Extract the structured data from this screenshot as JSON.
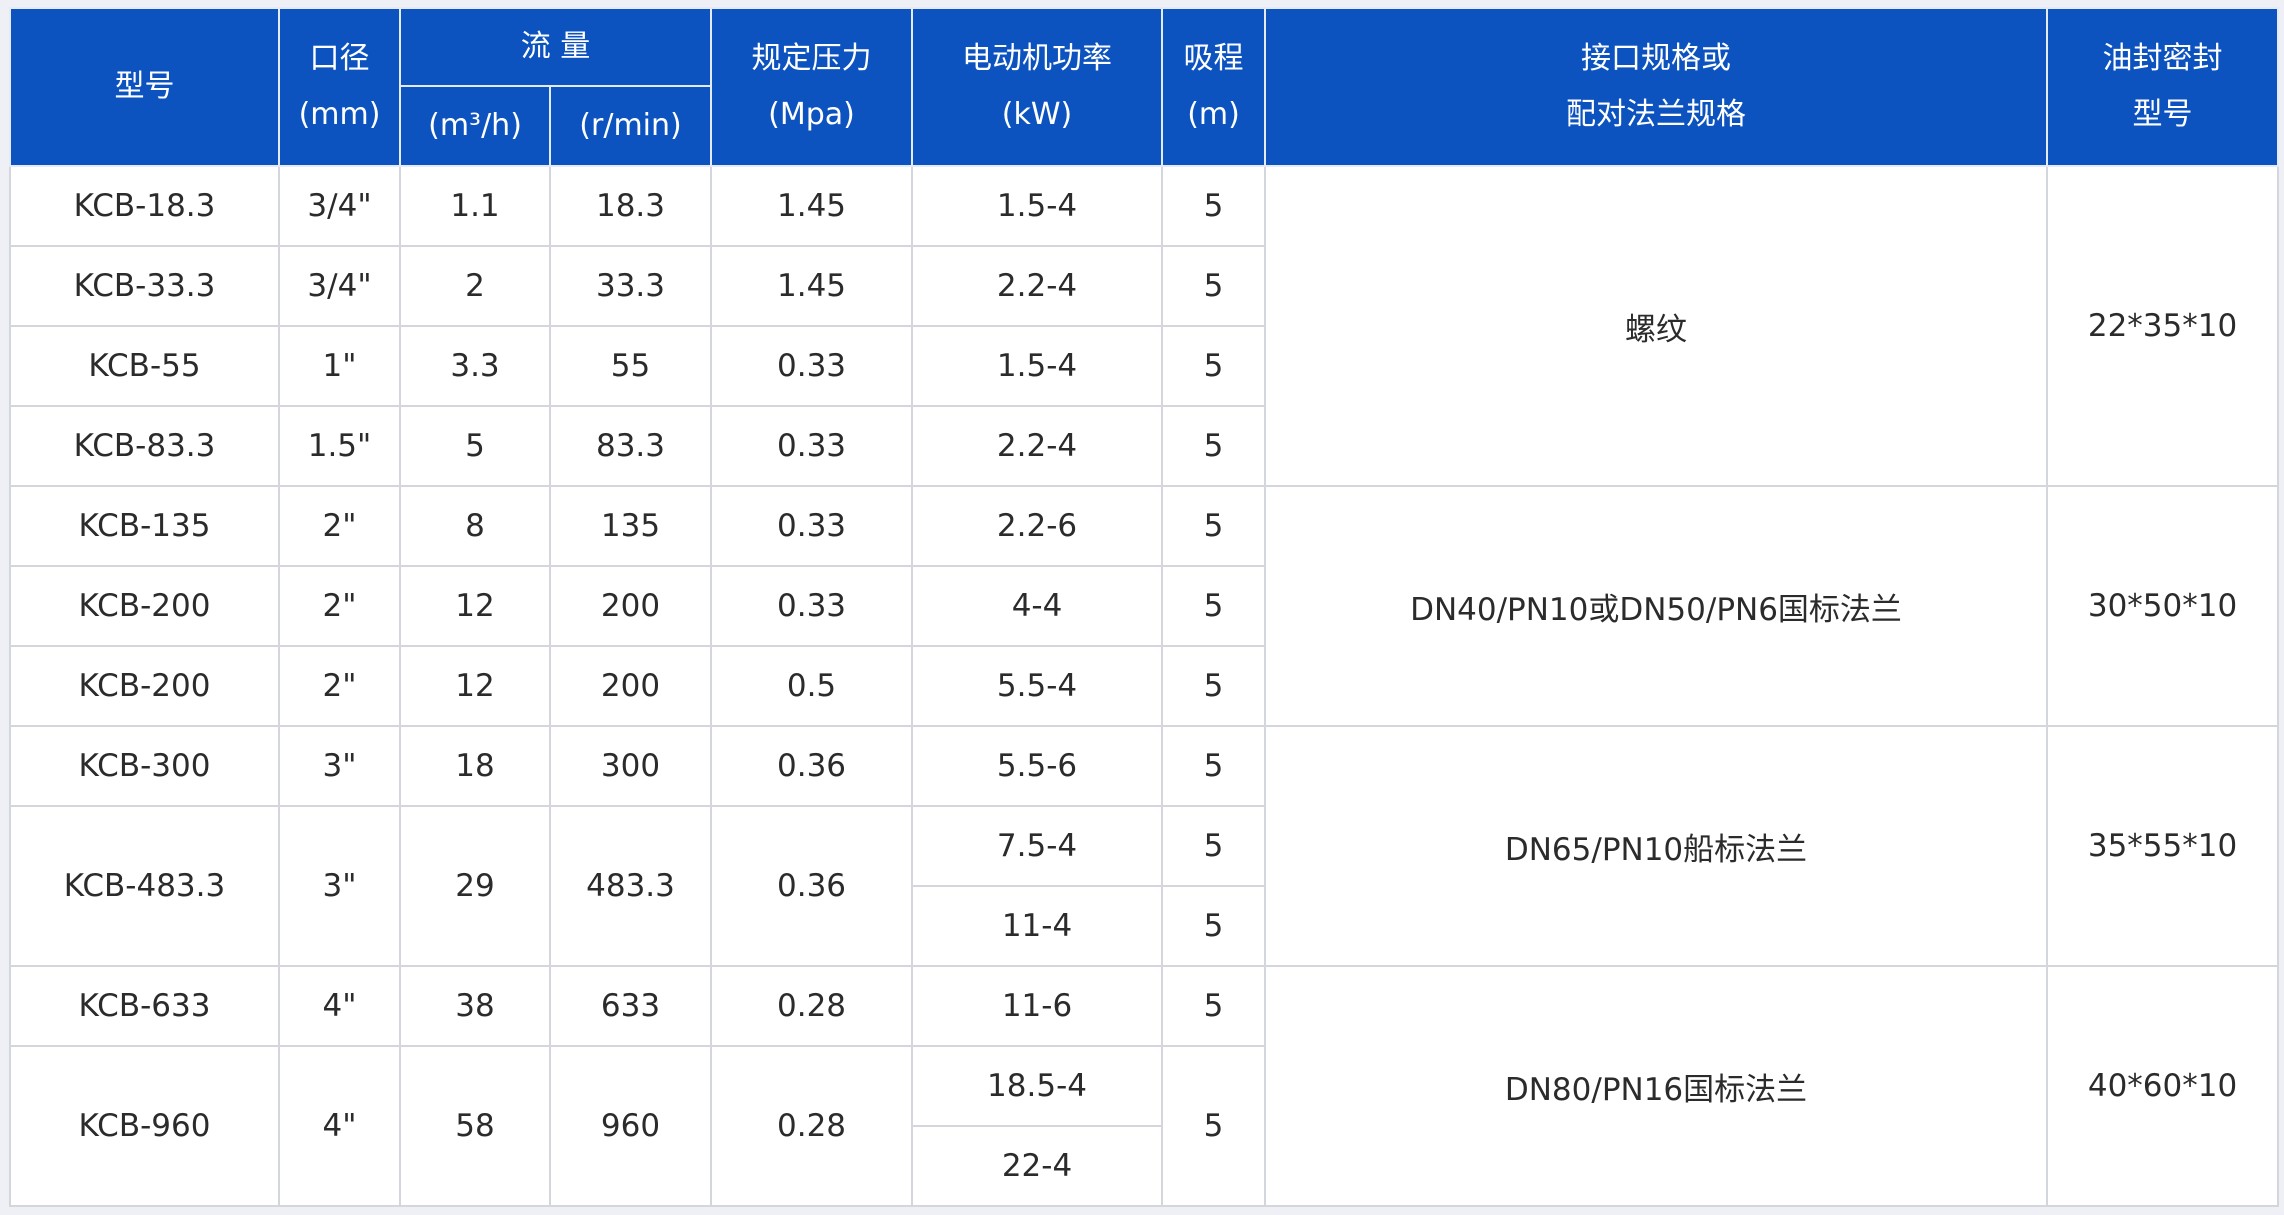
{
  "header": {
    "model": "型号",
    "bore": [
      "口径",
      "(mm)"
    ],
    "flow": "流 量",
    "flow_m3h": "m³/h",
    "flow_rmin": "(r/min)",
    "pressure": [
      "规定压力",
      "(Mpa)"
    ],
    "power": [
      "电动机功率",
      "(kW)"
    ],
    "suction": [
      "吸程",
      "(m)"
    ],
    "interface": [
      "接口规格或",
      "配对法兰规格"
    ],
    "seal": [
      "油封密封",
      "型号"
    ]
  },
  "rows": [
    {
      "model": "KCB-18.3",
      "bore": "3/4\"",
      "m3h": "1.1",
      "rmin": "18.3",
      "pressure": "1.45",
      "power": "1.5-4",
      "suction": "5"
    },
    {
      "model": "KCB-33.3",
      "bore": "3/4\"",
      "m3h": "2",
      "rmin": "33.3",
      "pressure": "1.45",
      "power": "2.2-4",
      "suction": "5"
    },
    {
      "model": "KCB-55",
      "bore": "1\"",
      "m3h": "3.3",
      "rmin": "55",
      "pressure": "0.33",
      "power": "1.5-4",
      "suction": "5"
    },
    {
      "model": "KCB-83.3",
      "bore": "1.5\"",
      "m3h": "5",
      "rmin": "83.3",
      "pressure": "0.33",
      "power": "2.2-4",
      "suction": "5"
    },
    {
      "model": "KCB-135",
      "bore": "2\"",
      "m3h": "8",
      "rmin": "135",
      "pressure": "0.33",
      "power": "2.2-6",
      "suction": "5"
    },
    {
      "model": "KCB-200",
      "bore": "2\"",
      "m3h": "12",
      "rmin": "200",
      "pressure": "0.33",
      "power": "4-4",
      "suction": "5"
    },
    {
      "model": "KCB-200",
      "bore": "2\"",
      "m3h": "12",
      "rmin": "200",
      "pressure": "0.5",
      "power": "5.5-4",
      "suction": "5"
    },
    {
      "model": "KCB-300",
      "bore": "3\"",
      "m3h": "18",
      "rmin": "300",
      "pressure": "0.36",
      "power": "5.5-6",
      "suction": "5"
    },
    {
      "model": "KCB-483.3",
      "bore": "3\"",
      "m3h": "29",
      "rmin": "483.3",
      "pressure": "0.36",
      "power": "7.5-4",
      "power_b": "11-4",
      "suction": "5",
      "suction_b": "5"
    },
    {
      "model": "KCB-633",
      "bore": "4\"",
      "m3h": "38",
      "rmin": "633",
      "pressure": "0.28",
      "power": "11-6",
      "suction": "5"
    },
    {
      "model": "KCB-960",
      "bore": "4\"",
      "m3h": "58",
      "rmin": "960",
      "pressure": "0.28",
      "power": "18.5-4",
      "power_b": "22-4",
      "suction": "5"
    }
  ],
  "groups": [
    {
      "interface": "螺纹",
      "seal": "22*35*10"
    },
    {
      "interface": "DN40/PN10或DN50/PN6国标法兰",
      "seal": "30*50*10"
    },
    {
      "interface": "DN65/PN10船标法兰",
      "seal": "35*55*10"
    },
    {
      "interface": "DN80/PN16国标法兰",
      "seal": "40*60*10"
    }
  ],
  "colors": {
    "header_bg": "#0d53bf",
    "header_text": "#ffffff",
    "border": "#d3d6dc"
  }
}
